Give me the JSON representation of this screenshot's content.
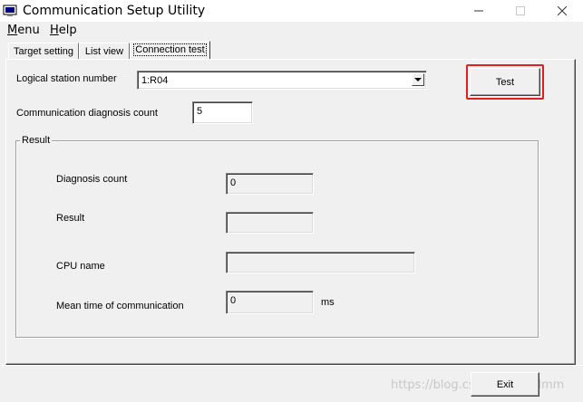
{
  "window": {
    "title": "Communication Setup Utility",
    "icons": {
      "app": "app-icon",
      "minimize": "minimize-icon",
      "maximize": "maximize-icon",
      "close": "close-icon"
    }
  },
  "menubar": {
    "menu": {
      "first": "M",
      "rest": "enu"
    },
    "help": {
      "first": "H",
      "rest": "elp"
    }
  },
  "tabs": [
    {
      "label": "Target setting"
    },
    {
      "label": "List view"
    },
    {
      "label": "Connection test",
      "active": true
    }
  ],
  "connection_test": {
    "logical_station_label": "Logical station number",
    "logical_station_value": "1:R04",
    "test_button": "Test",
    "diag_count_label": "Communication diagnosis count",
    "diag_count_value": "5",
    "result_group": {
      "title": "Result",
      "diagnosis_count_label": "Diagnosis count",
      "diagnosis_count_value": "0",
      "result_label": "Result",
      "result_value": "",
      "cpu_name_label": "CPU name",
      "cpu_name_value": "",
      "mean_time_label": "Mean time of communication",
      "mean_time_value": "0",
      "mean_time_unit": "ms"
    }
  },
  "footer": {
    "exit_button": "Exit",
    "watermark": "https://blog.csdn.net/zlddmm"
  },
  "colors": {
    "highlight": "#e02020",
    "background": "#f0f0f0"
  }
}
